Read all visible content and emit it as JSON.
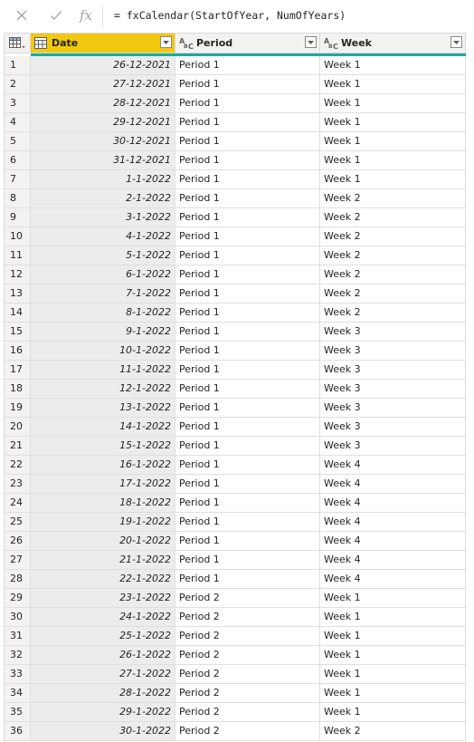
{
  "formula_bar": {
    "cancel_icon": "close-icon",
    "commit_icon": "check-icon",
    "fx_label": "fx",
    "formula": "= fxCalendar(StartOfYear, NumOfYears)"
  },
  "columns": {
    "date": "Date",
    "period": "Period",
    "week": "Week",
    "abc_label": "ABC"
  },
  "colors": {
    "selected_header": "#f2c811",
    "quality_bar": "#1aab9b"
  },
  "rows": [
    {
      "n": "1",
      "date": "26-12-2021",
      "period": "Period 1",
      "week": "Week 1"
    },
    {
      "n": "2",
      "date": "27-12-2021",
      "period": "Period 1",
      "week": "Week 1"
    },
    {
      "n": "3",
      "date": "28-12-2021",
      "period": "Period 1",
      "week": "Week 1"
    },
    {
      "n": "4",
      "date": "29-12-2021",
      "period": "Period 1",
      "week": "Week 1"
    },
    {
      "n": "5",
      "date": "30-12-2021",
      "period": "Period 1",
      "week": "Week 1"
    },
    {
      "n": "6",
      "date": "31-12-2021",
      "period": "Period 1",
      "week": "Week 1"
    },
    {
      "n": "7",
      "date": "1-1-2022",
      "period": "Period 1",
      "week": "Week 1"
    },
    {
      "n": "8",
      "date": "2-1-2022",
      "period": "Period 1",
      "week": "Week 2"
    },
    {
      "n": "9",
      "date": "3-1-2022",
      "period": "Period 1",
      "week": "Week 2"
    },
    {
      "n": "10",
      "date": "4-1-2022",
      "period": "Period 1",
      "week": "Week 2"
    },
    {
      "n": "11",
      "date": "5-1-2022",
      "period": "Period 1",
      "week": "Week 2"
    },
    {
      "n": "12",
      "date": "6-1-2022",
      "period": "Period 1",
      "week": "Week 2"
    },
    {
      "n": "13",
      "date": "7-1-2022",
      "period": "Period 1",
      "week": "Week 2"
    },
    {
      "n": "14",
      "date": "8-1-2022",
      "period": "Period 1",
      "week": "Week 2"
    },
    {
      "n": "15",
      "date": "9-1-2022",
      "period": "Period 1",
      "week": "Week 3"
    },
    {
      "n": "16",
      "date": "10-1-2022",
      "period": "Period 1",
      "week": "Week 3"
    },
    {
      "n": "17",
      "date": "11-1-2022",
      "period": "Period 1",
      "week": "Week 3"
    },
    {
      "n": "18",
      "date": "12-1-2022",
      "period": "Period 1",
      "week": "Week 3"
    },
    {
      "n": "19",
      "date": "13-1-2022",
      "period": "Period 1",
      "week": "Week 3"
    },
    {
      "n": "20",
      "date": "14-1-2022",
      "period": "Period 1",
      "week": "Week 3"
    },
    {
      "n": "21",
      "date": "15-1-2022",
      "period": "Period 1",
      "week": "Week 3"
    },
    {
      "n": "22",
      "date": "16-1-2022",
      "period": "Period 1",
      "week": "Week 4"
    },
    {
      "n": "23",
      "date": "17-1-2022",
      "period": "Period 1",
      "week": "Week 4"
    },
    {
      "n": "24",
      "date": "18-1-2022",
      "period": "Period 1",
      "week": "Week 4"
    },
    {
      "n": "25",
      "date": "19-1-2022",
      "period": "Period 1",
      "week": "Week 4"
    },
    {
      "n": "26",
      "date": "20-1-2022",
      "period": "Period 1",
      "week": "Week 4"
    },
    {
      "n": "27",
      "date": "21-1-2022",
      "period": "Period 1",
      "week": "Week 4"
    },
    {
      "n": "28",
      "date": "22-1-2022",
      "period": "Period 1",
      "week": "Week 4"
    },
    {
      "n": "29",
      "date": "23-1-2022",
      "period": "Period 2",
      "week": "Week 1"
    },
    {
      "n": "30",
      "date": "24-1-2022",
      "period": "Period 2",
      "week": "Week 1"
    },
    {
      "n": "31",
      "date": "25-1-2022",
      "period": "Period 2",
      "week": "Week 1"
    },
    {
      "n": "32",
      "date": "26-1-2022",
      "period": "Period 2",
      "week": "Week 1"
    },
    {
      "n": "33",
      "date": "27-1-2022",
      "period": "Period 2",
      "week": "Week 1"
    },
    {
      "n": "34",
      "date": "28-1-2022",
      "period": "Period 2",
      "week": "Week 1"
    },
    {
      "n": "35",
      "date": "29-1-2022",
      "period": "Period 2",
      "week": "Week 1"
    },
    {
      "n": "36",
      "date": "30-1-2022",
      "period": "Period 2",
      "week": "Week 2"
    }
  ]
}
